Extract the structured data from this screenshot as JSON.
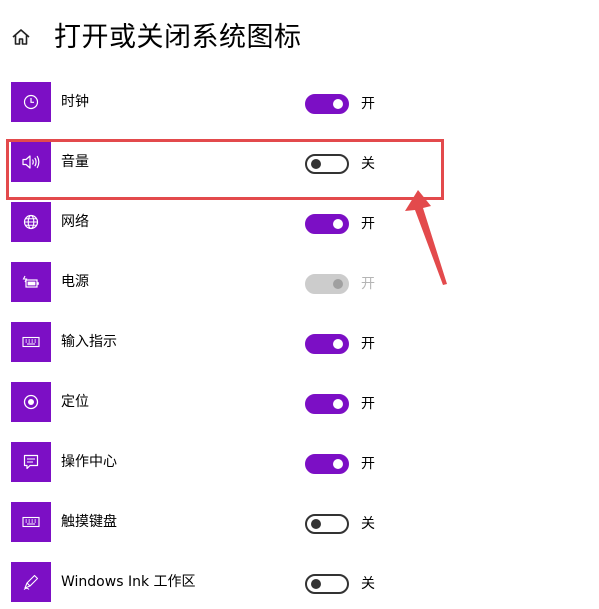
{
  "header": {
    "title": "打开或关闭系统图标",
    "home_icon": "home-icon"
  },
  "items": [
    {
      "label": "时钟",
      "icon": "clock-icon",
      "state": "on",
      "state_label": "开"
    },
    {
      "label": "音量",
      "icon": "volume-icon",
      "state": "off",
      "state_label": "关",
      "highlighted": true
    },
    {
      "label": "网络",
      "icon": "globe-icon",
      "state": "on",
      "state_label": "开"
    },
    {
      "label": "电源",
      "icon": "battery-icon",
      "state": "disabled",
      "state_label": "开"
    },
    {
      "label": "输入指示",
      "icon": "keyboard-icon",
      "state": "on",
      "state_label": "开"
    },
    {
      "label": "定位",
      "icon": "location-icon",
      "state": "on",
      "state_label": "开"
    },
    {
      "label": "操作中心",
      "icon": "action-center-icon",
      "state": "on",
      "state_label": "开"
    },
    {
      "label": "触摸键盘",
      "icon": "keyboard-icon",
      "state": "off",
      "state_label": "关"
    },
    {
      "label": "Windows Ink 工作区",
      "icon": "pen-icon",
      "state": "off",
      "state_label": "关"
    }
  ],
  "colors": {
    "accent": "#7c0fc5",
    "annotation": "#e34a4c",
    "disabled": "#cccccc"
  }
}
